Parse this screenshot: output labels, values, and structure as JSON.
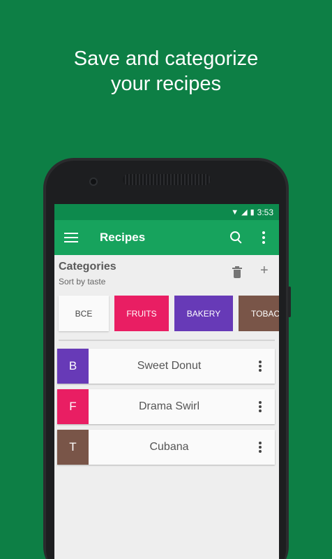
{
  "headline": {
    "line1": "Save and categorize",
    "line2": "your recipes"
  },
  "status_bar": {
    "time": "3:53"
  },
  "toolbar": {
    "title": "Recipes",
    "search_icon": "search-icon",
    "more_icon": "more-vert-icon",
    "menu_icon": "hamburger-menu-icon"
  },
  "categories": {
    "title": "Categories",
    "subtitle": "Sort by taste",
    "items": [
      {
        "label": "BCE",
        "color": "#fafafa"
      },
      {
        "label": "FRUITS",
        "color": "#e91e63"
      },
      {
        "label": "BAKERY",
        "color": "#673ab7"
      },
      {
        "label": "TOBAC",
        "color": "#795548"
      }
    ]
  },
  "recipes": [
    {
      "letter": "B",
      "name": "Sweet Donut",
      "color": "#673ab7"
    },
    {
      "letter": "F",
      "name": "Drama Swirl",
      "color": "#e91e63"
    },
    {
      "letter": "T",
      "name": "Cubana",
      "color": "#795548"
    }
  ],
  "colors": {
    "background": "#0d7f45",
    "toolbar": "#17a35d",
    "status_bar": "#0d8a4d"
  }
}
